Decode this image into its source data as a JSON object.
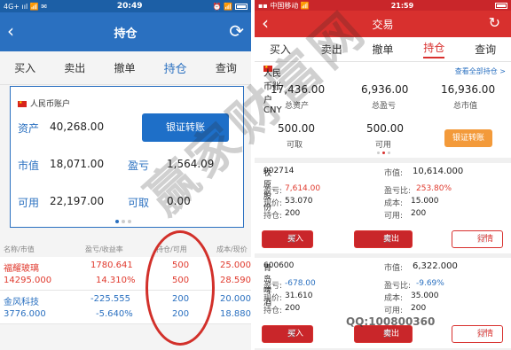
{
  "left": {
    "status": {
      "carrier": "4G+ ııl 📶 ✉",
      "time": "20:49",
      "icons": "⏰ 📶"
    },
    "nav": {
      "title": "持仓",
      "back_icon": "chevron-left-icon",
      "refresh_icon": "refresh-icon"
    },
    "tabs": [
      "买入",
      "卖出",
      "撤单",
      "持仓",
      "查询"
    ],
    "account": {
      "name": "人民币账户",
      "zichan_label": "资产",
      "zichan": "40,268.00",
      "shizhi_label": "市值",
      "shizhi": "18,071.00",
      "yingkui_label": "盈亏",
      "yingkui": "1,564.09",
      "keyong_label": "可用",
      "keyong": "22,197.00",
      "kequ_label": "可取",
      "kequ": "0.00",
      "transfer": "银证转账"
    },
    "table_headers": [
      "名称/市值",
      "盈亏/收益率",
      "持仓/可用",
      "成本/现价"
    ],
    "holdings": [
      {
        "name": "福耀玻璃",
        "mv": "14295.000",
        "pl": "1780.641",
        "rate": "14.310%",
        "hold": "500",
        "avail": "500",
        "cost": "25.000",
        "price": "28.590",
        "color": "red"
      },
      {
        "name": "金风科技",
        "mv": "3776.000",
        "pl": "-225.555",
        "rate": "-5.640%",
        "hold": "200",
        "avail": "200",
        "cost": "20.000",
        "price": "18.880",
        "color": "blue"
      }
    ]
  },
  "right": {
    "status": {
      "carrier": "▪▪ 中国移动 📶",
      "time": "21:59",
      "battery": "■"
    },
    "nav": {
      "title": "交易",
      "back_icon": "chevron-left-icon",
      "refresh_icon": "refresh-icon"
    },
    "tabs": [
      "买入",
      "卖出",
      "撤单",
      "持仓",
      "查询"
    ],
    "summary": {
      "account": "人民币账户CNY",
      "view_all": "查看全部持仓 >",
      "total_assets": "17,436.00",
      "total_assets_label": "总资产",
      "profit": "6,936.00",
      "profit_label": "总盈亏",
      "market_value": "16,936.00",
      "market_value_label": "总市值",
      "withdrawable": "500.00",
      "withdrawable_label": "可取",
      "available": "500.00",
      "available_label": "可用",
      "transfer": "银证转账"
    },
    "positions": [
      {
        "name": "牧原股份",
        "code": "002714",
        "mv_label": "市值:",
        "mv": "10,614.000",
        "pl_label": "盈亏:",
        "pl": "7,614.00",
        "plr_label": "盈亏比:",
        "plr": "253.80%",
        "price_label": "现价:",
        "price": "53.070",
        "cost_label": "成本:",
        "cost": "15.000",
        "hold_label": "持仓:",
        "hold": "200",
        "avail_label": "可用:",
        "avail": "200",
        "color": "red"
      },
      {
        "name": "青岛啤酒",
        "code": "600600",
        "mv_label": "市值:",
        "mv": "6,322.000",
        "pl_label": "盈亏:",
        "pl": "-678.00",
        "plr_label": "盈亏比:",
        "plr": "-9.69%",
        "price_label": "现价:",
        "price": "31.610",
        "cost_label": "成本:",
        "cost": "35.000",
        "hold_label": "持仓:",
        "hold": "200",
        "avail_label": "可用:",
        "avail": "200",
        "color": "blue"
      }
    ],
    "buttons": {
      "buy": "买入",
      "sell": "卖出",
      "quote": "行情"
    }
  },
  "watermark": "赢家财富网",
  "watermark_url": "www.yjcf360.com",
  "qq": "QQ:100800360"
}
